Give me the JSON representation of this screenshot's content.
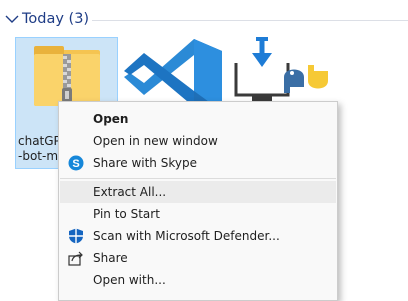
{
  "group": {
    "title": "Today (3)"
  },
  "files": [
    {
      "label_line1": "chatGP",
      "label_line2": "-bot-m",
      "icon": "zip-folder-icon"
    },
    {
      "icon": "vscode-icon"
    },
    {
      "icon": "python-installer-icon"
    }
  ],
  "context_menu": {
    "items": [
      {
        "label": "Open"
      },
      {
        "label": "Open in new window"
      },
      {
        "label": "Share with Skype"
      },
      {
        "label": "Extract All..."
      },
      {
        "label": "Pin to Start"
      },
      {
        "label": "Scan with Microsoft Defender..."
      },
      {
        "label": "Share"
      },
      {
        "label": "Open with..."
      }
    ]
  },
  "colors": {
    "accent": "#1f3d86",
    "selection": "#cce4f7",
    "menu_bg": "#f9f9f9",
    "menu_hover": "#ebebeb"
  }
}
